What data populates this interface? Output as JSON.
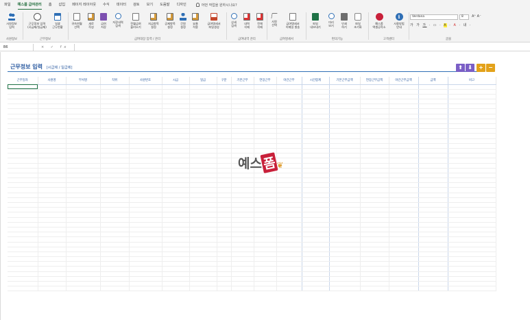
{
  "tabs": [
    "파일",
    "예스폼 급여관리",
    "홈",
    "삽입",
    "페이지 레이아웃",
    "수식",
    "데이터",
    "검토",
    "보기",
    "도움말",
    "디자인"
  ],
  "active_tab_index": 1,
  "tellme": "어떤 작업을 원하시나요?",
  "ribbon": {
    "groups": [
      "사원정보",
      "근무정보",
      "급여대장 입력 / 관리",
      "급여내역 관리",
      "급여명세서",
      "편의기능",
      "고객센터",
      "글꼴"
    ],
    "buttons": {
      "b1": "사원정보\n입력",
      "b2": "근무정보 입력\n(시급제/일급제)",
      "b3": "일괄\n근무현황",
      "b4": "귀속연월\n선택",
      "b5": "새로\n작성",
      "b6": "급여\n저장",
      "b7": "저장내역\n검색",
      "b8": "전월급여\n불러오기",
      "b9": "지급항목\n설정",
      "b10": "공제항목\n설정",
      "b11": "간원\n설정",
      "b12": "요율\n적용",
      "b13": "급여명세서\n파일생성",
      "b14": "상세\n검색",
      "b15": "내역\n삭제",
      "b16": "전체\n삭제",
      "b17": "사원\n선택",
      "b18": "급여명세서\n이메일 발송",
      "b19": "파일\n내보내기",
      "b20": "미리\n보기",
      "b21": "인쇄\n하기",
      "b22": "파일\n초기화",
      "b23": "예스폼\n엑셀공작소",
      "b24": "사용방법\n안내"
    },
    "font": {
      "name": "Verdana",
      "size": "8"
    }
  },
  "formula_bar": {
    "cell_ref": "B6",
    "formula": ""
  },
  "sheet": {
    "title": "근무정보 입력",
    "subtitle": "[시급제 / 일급제]",
    "headers": [
      "근무일자",
      "사원명",
      "부서명",
      "직위",
      "사원번호",
      "시급",
      "일급",
      "구분",
      "기본근무",
      "연장근무",
      "야간근무",
      "시간합계",
      "기본근무금액",
      "연장근무금액",
      "야간근무금액",
      "금액",
      "비고"
    ]
  },
  "watermark": {
    "left": "예스",
    "mark": "폼"
  },
  "colors": {
    "accent": "#1e6b3a",
    "title": "#2a5aa0",
    "move_buttons": "#7b5fc6",
    "plus_minus": "#e3a21a"
  }
}
